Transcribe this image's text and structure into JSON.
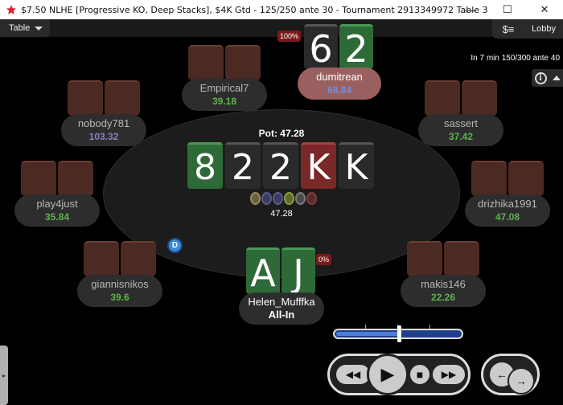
{
  "window": {
    "title": "$7.50 NLHE [Progressive KO, Deep Stacks], $4K Gtd - 125/250 ante 30 - Tournament 2913349972 Table 3",
    "minimize": "—",
    "maximize": "☐",
    "close": "✕"
  },
  "toolbar": {
    "table_menu": "Table",
    "cashier_icon": "$≡",
    "lobby": "Lobby",
    "next_blinds": "In 7 min 150/300 ante 40",
    "info": "i"
  },
  "pot": {
    "label": "Pot: 47.28",
    "amount": "47.28"
  },
  "board": [
    {
      "rank": "8",
      "suit": "club"
    },
    {
      "rank": "2",
      "suit": "spade"
    },
    {
      "rank": "2",
      "suit": "spade"
    },
    {
      "rank": "K",
      "suit": "heart"
    },
    {
      "rank": "K",
      "suit": "spade"
    }
  ],
  "players": {
    "empirical7": {
      "name": "Empirical7",
      "stack": "39.18"
    },
    "nobody781": {
      "name": "nobody781",
      "stack": "103.32"
    },
    "sassert": {
      "name": "sassert",
      "stack": "37.42"
    },
    "play4just": {
      "name": "play4just",
      "stack": "35.84"
    },
    "drizhika1991": {
      "name": "drizhika1991",
      "stack": "47.08"
    },
    "giannisnikos": {
      "name": "giannisnikos",
      "stack": "39.6"
    },
    "makis146": {
      "name": "makis146",
      "stack": "22.26"
    },
    "dumitrean": {
      "name": "dumitrean",
      "stack": "68.84",
      "equity": "100%",
      "cards": [
        {
          "rank": "6",
          "suit": "spade"
        },
        {
          "rank": "2",
          "suit": "club"
        }
      ]
    },
    "helen": {
      "name": "Helen_Mufffka",
      "stack": "All-In",
      "equity": "0%",
      "cards": [
        {
          "rank": "A",
          "suit": "club"
        },
        {
          "rank": "J",
          "suit": "club"
        }
      ]
    }
  },
  "dealer_button": "D",
  "bet_slider": {
    "fraction": 0.5
  },
  "replay": {
    "rewind": "◀◀",
    "play": "▶",
    "stop": "■",
    "fast_forward": "▶▶",
    "prev_hand": "←",
    "next_hand": "→"
  },
  "colors": {
    "stack_green": "#5ab54a",
    "hero_plate": "#9a6060",
    "equity_red": "#7a1a1a"
  }
}
